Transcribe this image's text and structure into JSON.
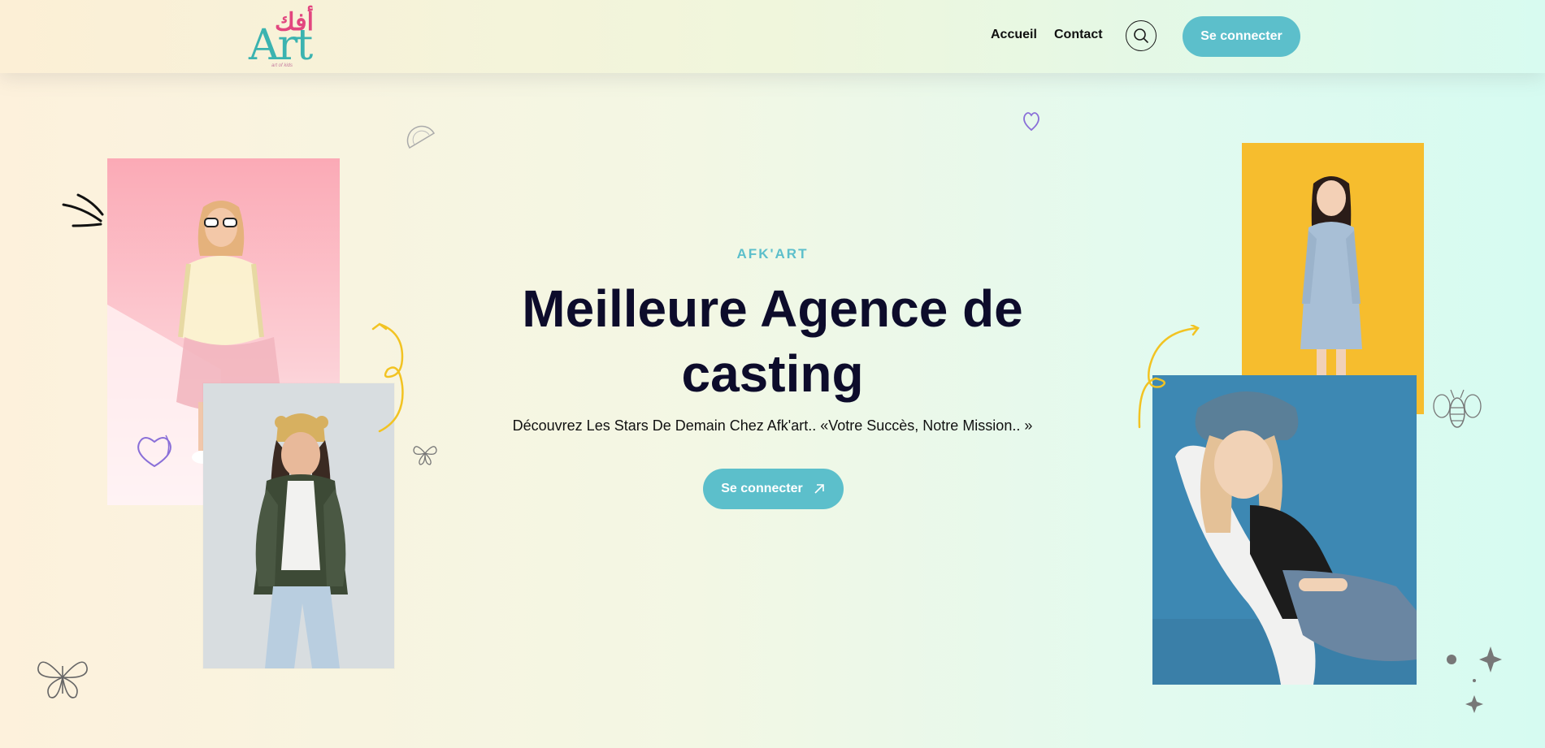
{
  "brand": {
    "logo_arabic": "أفك",
    "logo_latin": "Art",
    "logo_tagline": "art of kids"
  },
  "nav": {
    "items": [
      "Accueil",
      "Contact"
    ],
    "login_label": "Se connecter"
  },
  "hero": {
    "eyebrow": "AFK'ART",
    "title_line1": "Meilleure Agence de",
    "title_line2": "casting",
    "subtitle": "Découvrez Les Stars De Demain Chez Afk'art.. «Votre Succès, Notre Mission.. »",
    "cta_label": "Se connecter",
    "cta_icon": "arrow-up-right-icon"
  },
  "colors": {
    "accent": "#5cbfcb",
    "title": "#0d0c2b",
    "photo_pink": "#f8b6c0",
    "photo_grey": "#d7dcdf",
    "photo_yellow": "#f6bd2e",
    "photo_blue": "#3d88b3"
  },
  "photos": [
    {
      "name": "girl-sunglasses-photo",
      "bg": "pink"
    },
    {
      "name": "girl-beanie-photo",
      "bg": "grey"
    },
    {
      "name": "girl-denim-dress-photo",
      "bg": "yellow"
    },
    {
      "name": "girl-cap-chair-photo",
      "bg": "blue"
    }
  ]
}
